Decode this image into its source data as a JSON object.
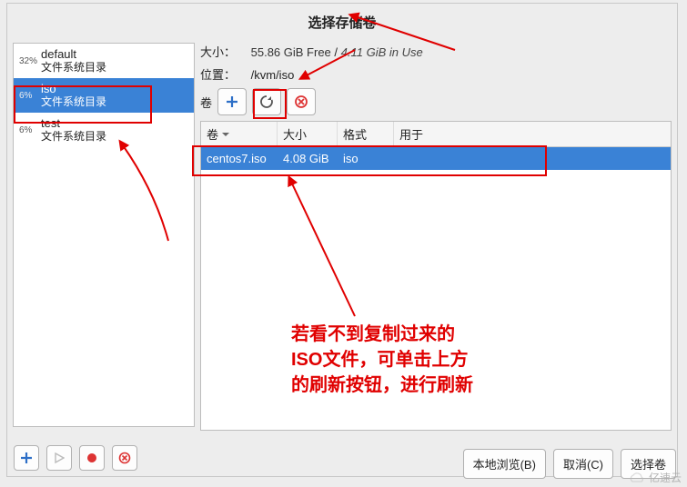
{
  "title": "选择存储卷",
  "sidebar": {
    "pools": [
      {
        "pct": "32%",
        "name": "default",
        "sub": "文件系统目录"
      },
      {
        "pct": "6%",
        "name": "iso",
        "sub": "文件系统目录"
      },
      {
        "pct": "6%",
        "name": "test",
        "sub": "文件系统目录"
      }
    ]
  },
  "info": {
    "size_label": "大小：",
    "free": "55.86 GiB Free",
    "sep": "/",
    "used": "4.11 GiB in Use",
    "loc_label": "位置：",
    "loc_value": "/kvm/iso",
    "vol_label": "卷"
  },
  "table": {
    "cols": {
      "vol": "卷",
      "size": "大小",
      "fmt": "格式",
      "use": "用于"
    },
    "row": {
      "vol": "centos7.iso",
      "size": "4.08 GiB",
      "fmt": "iso",
      "use": ""
    }
  },
  "footer": {
    "local": "本地浏览(B)",
    "cancel": "取消(C)",
    "choose": "选择卷"
  },
  "note_line1": "若看不到复制过来的",
  "note_line2": "ISO文件，可单击上方",
  "note_line3": "的刷新按钮，进行刷新",
  "watermark": "亿速云"
}
